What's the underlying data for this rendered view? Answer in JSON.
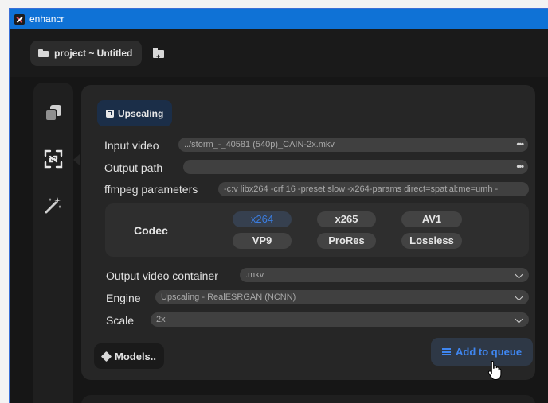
{
  "window": {
    "title": "enhancr"
  },
  "topbar": {
    "project_label": "project ~ Untitled"
  },
  "sidebar": {
    "items": [
      "queue-icon",
      "upscale-icon",
      "enhance-magic-icon"
    ],
    "active": 1
  },
  "panel": {
    "badge": "Upscaling",
    "input_video": {
      "label": "Input video",
      "value": "../storm_-_40581 (540p)_CAIN-2x.mkv"
    },
    "output_path": {
      "label": "Output path",
      "value": ""
    },
    "ffmpeg": {
      "label": "ffmpeg parameters",
      "value": "-c:v libx264 -crf 16 -preset slow -x264-params direct=spatial:me=umh -"
    },
    "codec": {
      "label": "Codec",
      "options": [
        "x264",
        "x265",
        "AV1",
        "VP9",
        "ProRes",
        "Lossless"
      ],
      "selected": "x264"
    },
    "container": {
      "label": "Output video container",
      "value": ".mkv"
    },
    "engine": {
      "label": "Engine",
      "value": "Upscaling - RealESRGAN (NCNN)"
    },
    "scale": {
      "label": "Scale",
      "value": "2x"
    },
    "models_button": "Models..",
    "queue_button": "Add to queue"
  },
  "colors": {
    "titlebar": "#0f72d6",
    "accent": "#3f86f0",
    "background": "#161616",
    "panel": "#262626"
  }
}
